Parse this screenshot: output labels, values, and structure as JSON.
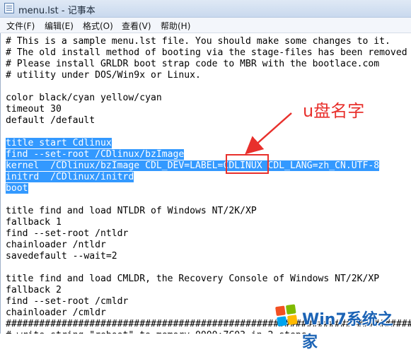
{
  "window": {
    "title": "menu.lst - 记事本"
  },
  "menu": [
    {
      "label": "文件(F)"
    },
    {
      "label": "编辑(E)"
    },
    {
      "label": "格式(O)"
    },
    {
      "label": "查看(V)"
    },
    {
      "label": "帮助(H)"
    }
  ],
  "lines": [
    {
      "text": "# This is a sample menu.lst file. You should make some changes to it.",
      "selected": false
    },
    {
      "text": "# The old install method of booting via the stage-files has been removed",
      "selected": false
    },
    {
      "text": "# Please install GRLDR boot strap code to MBR with the bootlace.com",
      "selected": false
    },
    {
      "text": "# utility under DOS/Win9x or Linux.",
      "selected": false
    },
    {
      "text": "",
      "selected": false
    },
    {
      "text": "color black/cyan yellow/cyan",
      "selected": false
    },
    {
      "text": "timeout 30",
      "selected": false
    },
    {
      "text": "default /default",
      "selected": false
    },
    {
      "text": "",
      "selected": false
    },
    {
      "text": "title start Cdlinux",
      "selected": true
    },
    {
      "text": "find --set-root /CDlinux/bzImage",
      "selected": true
    },
    {
      "text": "kernel  /CDlinux/bzImage CDL_DEV=LABEL=CDLINUX CDL_LANG=zh_CN.UTF-8",
      "selected": true
    },
    {
      "text": "initrd  /CDlinux/initrd",
      "selected": true
    },
    {
      "text": "boot",
      "selected": true
    },
    {
      "text": "",
      "selected": false
    },
    {
      "text": "title find and load NTLDR of Windows NT/2K/XP",
      "selected": false
    },
    {
      "text": "fallback 1",
      "selected": false
    },
    {
      "text": "find --set-root /ntldr",
      "selected": false
    },
    {
      "text": "chainloader /ntldr",
      "selected": false
    },
    {
      "text": "savedefault --wait=2",
      "selected": false
    },
    {
      "text": "",
      "selected": false
    },
    {
      "text": "title find and load CMLDR, the Recovery Console of Windows NT/2K/XP",
      "selected": false
    },
    {
      "text": "fallback 2",
      "selected": false
    },
    {
      "text": "find --set-root /cmldr",
      "selected": false
    },
    {
      "text": "chainloader /cmldr",
      "selected": false
    },
    {
      "text": "##########################################################################",
      "selected": false
    },
    {
      "text": "# write string \"reboot\" to memory 0000:7C03 in 2 steps:",
      "selected": false
    }
  ],
  "annotation": {
    "label": "u盘名字",
    "color": "#e8302c"
  },
  "watermark": {
    "text": "Win7系统之家"
  },
  "colors": {
    "selection": "#3399ff",
    "annotation": "#e8302c"
  }
}
